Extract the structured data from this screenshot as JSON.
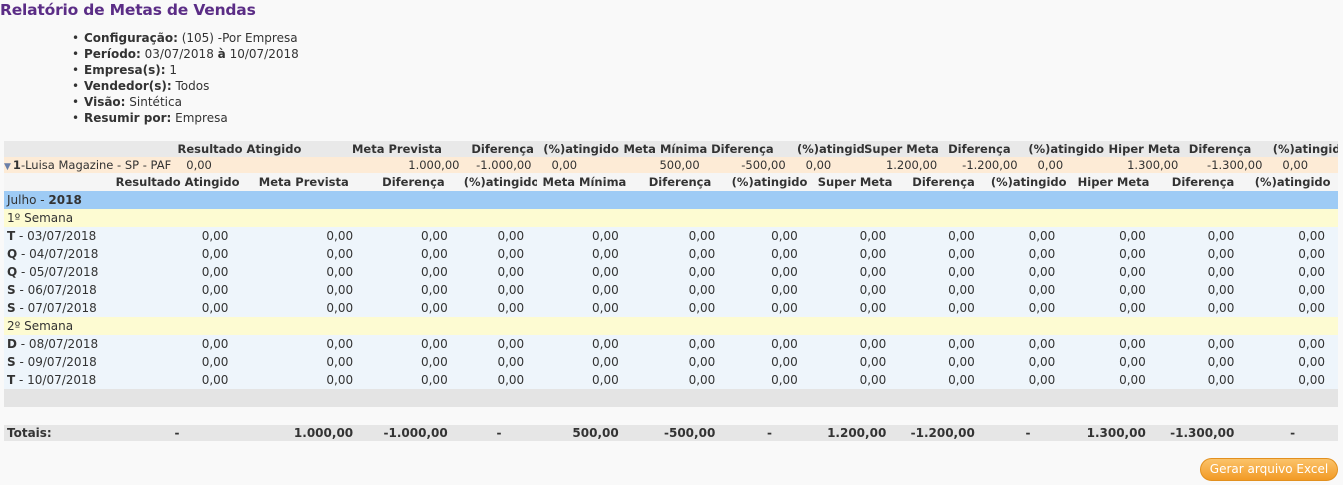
{
  "page_title": "Relatório de Metas de Vendas",
  "params": [
    {
      "label": "Configuração:",
      "value": " (105) -Por Empresa"
    },
    {
      "label": "Período:",
      "value": " 03/07/2018 ",
      "bold_mid": "à",
      "value2": " 10/07/2018"
    },
    {
      "label": "Empresa(s):",
      "value": " 1"
    },
    {
      "label": "Vendedor(s):",
      "value": " Todos"
    },
    {
      "label": "Visão:",
      "value": " Sintética"
    },
    {
      "label": "Resumir por:",
      "value": " Empresa"
    }
  ],
  "summary": {
    "headers": [
      "Resultado Atingido",
      "Meta Prevista",
      "Diferença",
      "(%)atingido",
      "Meta Mínima",
      "Diferença",
      "(%)atingido",
      "Super Meta",
      "Diferença",
      "(%)atingido",
      "Hiper Meta",
      "Diferença",
      "(%)atingido"
    ],
    "company_code": "1",
    "company_name": "-Luisa Magazine - SP - PAF",
    "values": [
      "0,00",
      "1.000,00",
      "-1.000,00",
      "0,00",
      "500,00",
      "-500,00",
      "0,00",
      "1.200,00",
      "-1.200,00",
      "0,00",
      "1.300,00",
      "-1.300,00",
      "0,00"
    ]
  },
  "detail": {
    "headers": [
      "Resultado Atingido",
      "Meta Prevista",
      "Diferença",
      "(%)atingido",
      "Meta Mínima",
      "Diferença",
      "(%)atingido",
      "Super Meta",
      "Diferença",
      "(%)atingido",
      "Hiper Meta",
      "Diferença",
      "(%)atingido"
    ],
    "month": "Julho - ",
    "year": "2018",
    "weeks": [
      {
        "label": "1º Semana",
        "days": [
          {
            "dow": "T",
            "date": " - 03/07/2018"
          },
          {
            "dow": "Q",
            "date": " - 04/07/2018"
          },
          {
            "dow": "Q",
            "date": " - 05/07/2018"
          },
          {
            "dow": "S",
            "date": " - 06/07/2018"
          },
          {
            "dow": "S",
            "date": " - 07/07/2018"
          }
        ]
      },
      {
        "label": "2º Semana",
        "days": [
          {
            "dow": "D",
            "date": " - 08/07/2018"
          },
          {
            "dow": "S",
            "date": " - 09/07/2018"
          },
          {
            "dow": "T",
            "date": " - 10/07/2018"
          }
        ]
      }
    ],
    "cell_value": "0,00"
  },
  "totals": {
    "label": "Totais:",
    "values": [
      "-",
      "1.000,00",
      "-1.000,00",
      "-",
      "500,00",
      "-500,00",
      "-",
      "1.200,00",
      "-1.200,00",
      "-",
      "1.300,00",
      "-1.300,00",
      "-"
    ]
  },
  "excel_button": "Gerar arquivo Excel"
}
